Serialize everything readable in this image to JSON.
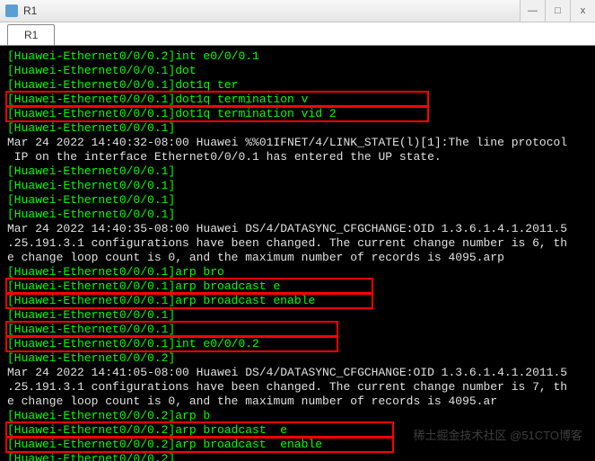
{
  "window": {
    "title": "R1",
    "min": "—",
    "max": "□",
    "close": "x"
  },
  "tabs": [
    {
      "label": "R1"
    }
  ],
  "lines": [
    {
      "text": "[Huawei-Ethernet0/0/0.2]int e0/0/0.1",
      "style": "green"
    },
    {
      "text": "[Huawei-Ethernet0/0/0.1]dot",
      "style": "green"
    },
    {
      "text": "[Huawei-Ethernet0/0/0.1]dot1q ter",
      "style": "green"
    },
    {
      "text": "[Huawei-Ethernet0/0/0.1]dot1q termination v",
      "style": "green",
      "boxed": true,
      "boxcols": 60
    },
    {
      "text": "[Huawei-Ethernet0/0/0.1]dot1q termination vid 2",
      "style": "green",
      "boxed": true,
      "boxcols": 60
    },
    {
      "text": "[Huawei-Ethernet0/0/0.1]",
      "style": "green"
    },
    {
      "text": "Mar 24 2022 14:40:32-08:00 Huawei %%01IFNET/4/LINK_STATE(l)[1]:The line protocol",
      "style": "white"
    },
    {
      "text": " IP on the interface Ethernet0/0/0.1 has entered the UP state.",
      "style": "white"
    },
    {
      "text": "[Huawei-Ethernet0/0/0.1]",
      "style": "green"
    },
    {
      "text": "[Huawei-Ethernet0/0/0.1]",
      "style": "green"
    },
    {
      "text": "[Huawei-Ethernet0/0/0.1]",
      "style": "green"
    },
    {
      "text": "[Huawei-Ethernet0/0/0.1]",
      "style": "green"
    },
    {
      "text": "Mar 24 2022 14:40:35-08:00 Huawei DS/4/DATASYNC_CFGCHANGE:OID 1.3.6.1.4.1.2011.5",
      "style": "white"
    },
    {
      "text": ".25.191.3.1 configurations have been changed. The current change number is 6, th",
      "style": "white"
    },
    {
      "text": "e change loop count is 0, and the maximum number of records is 4095.arp",
      "style": "white"
    },
    {
      "text": "[Huawei-Ethernet0/0/0.1]arp bro",
      "style": "green"
    },
    {
      "text": "[Huawei-Ethernet0/0/0.1]arp broadcast e",
      "style": "green",
      "boxed": true,
      "boxcols": 52
    },
    {
      "text": "[Huawei-Ethernet0/0/0.1]arp broadcast enable",
      "style": "green",
      "boxed": true,
      "boxcols": 52
    },
    {
      "text": "[Huawei-Ethernet0/0/0.1]",
      "style": "green"
    },
    {
      "text": "[Huawei-Ethernet0/0/0.1]",
      "style": "green",
      "boxed": true,
      "boxcols": 47
    },
    {
      "text": "[Huawei-Ethernet0/0/0.1]int e0/0/0.2",
      "style": "green",
      "boxed": true,
      "boxcols": 47
    },
    {
      "text": "[Huawei-Ethernet0/0/0.2]",
      "style": "green"
    },
    {
      "text": "Mar 24 2022 14:41:05-08:00 Huawei DS/4/DATASYNC_CFGCHANGE:OID 1.3.6.1.4.1.2011.5",
      "style": "white"
    },
    {
      "text": ".25.191.3.1 configurations have been changed. The current change number is 7, th",
      "style": "white"
    },
    {
      "text": "e change loop count is 0, and the maximum number of records is 4095.ar",
      "style": "white"
    },
    {
      "text": "[Huawei-Ethernet0/0/0.2]arp b",
      "style": "green"
    },
    {
      "text": "[Huawei-Ethernet0/0/0.2]arp broadcast  e",
      "style": "green",
      "boxed": true,
      "boxcols": 55
    },
    {
      "text": "[Huawei-Ethernet0/0/0.2]arp broadcast  enable",
      "style": "green",
      "boxed": true,
      "boxcols": 55
    },
    {
      "text": "[Huawei-Ethernet0/0/0.2]",
      "style": "green"
    }
  ],
  "watermark": "稀土掘金技术社区\n@51CTO博客"
}
